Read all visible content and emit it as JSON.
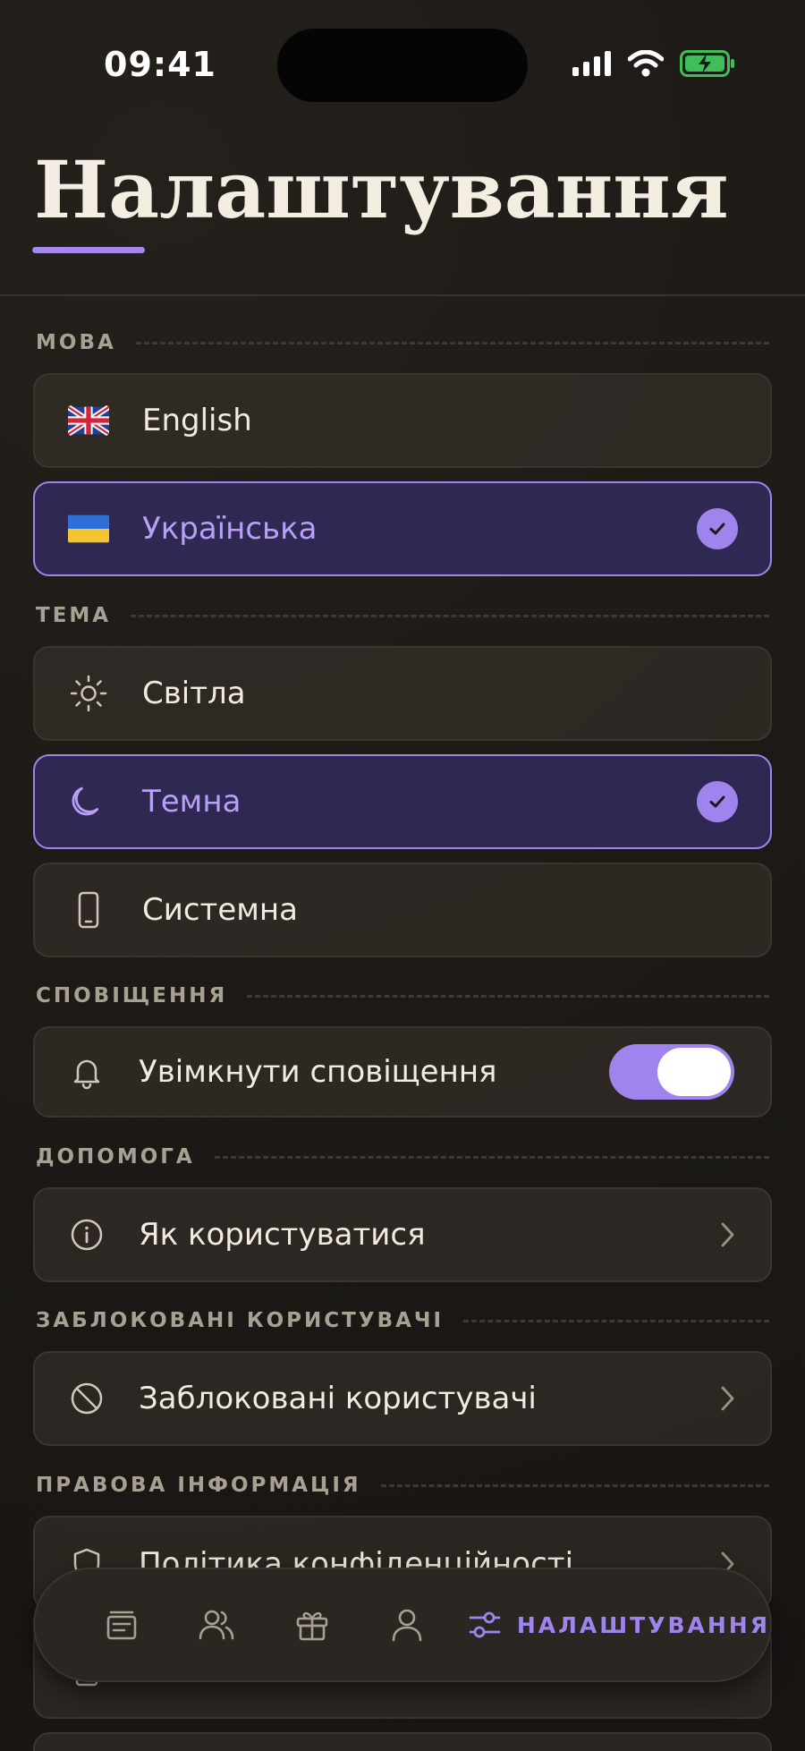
{
  "status_bar": {
    "time": "09:41"
  },
  "title": "Налаштування",
  "sections": {
    "language": {
      "label": "МОВА",
      "options": [
        {
          "label": "English",
          "flag": "uk-flag",
          "selected": false
        },
        {
          "label": "Українська",
          "flag": "ukraine-flag",
          "selected": true
        }
      ]
    },
    "theme": {
      "label": "ТЕМА",
      "options": [
        {
          "label": "Світла",
          "icon": "sun-icon",
          "selected": false
        },
        {
          "label": "Темна",
          "icon": "moon-icon",
          "selected": true
        },
        {
          "label": "Системна",
          "icon": "phone-icon",
          "selected": false
        }
      ]
    },
    "notifications": {
      "label": "СПОВІЩЕННЯ",
      "toggle_label": "Увімкнути сповіщення",
      "enabled": true
    },
    "help": {
      "label": "ДОПОМОГА",
      "item": "Як користуватися"
    },
    "blocked": {
      "label": "ЗАБЛОКОВАНІ КОРИСТУВАЧІ",
      "item": "Заблоковані користувачі"
    },
    "legal": {
      "label": "ПРАВОВА ІНФОРМАЦІЯ",
      "item": "Політика конфіденційності"
    }
  },
  "tabbar": {
    "tabs": [
      "feed-icon",
      "users-icon",
      "gift-icon",
      "profile-icon",
      "sliders-icon"
    ],
    "active_label": "НАЛАШТУВАННЯ"
  },
  "colors": {
    "accent": "#a084ee",
    "background": "#1d1a17",
    "selected_bg": "#2f2852"
  }
}
